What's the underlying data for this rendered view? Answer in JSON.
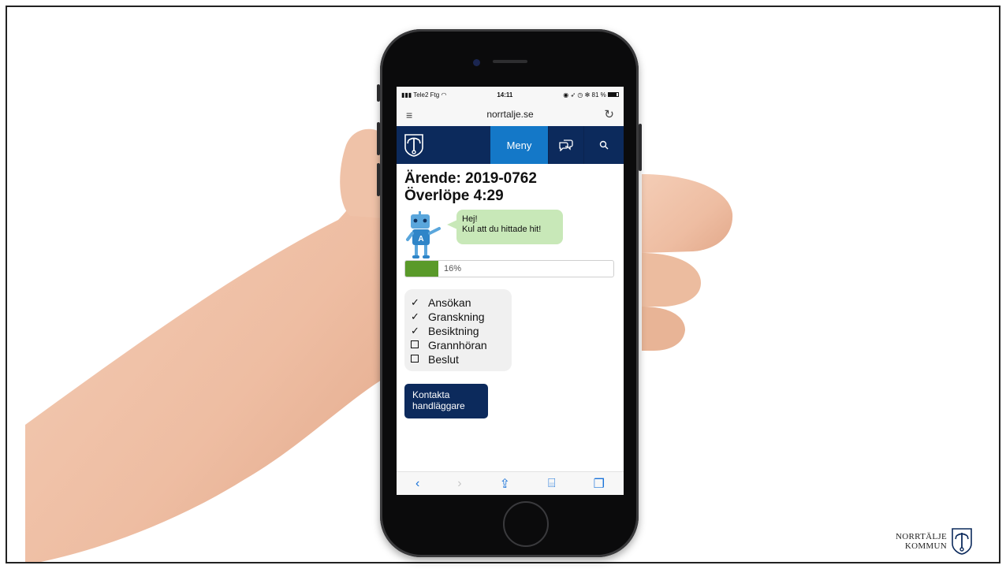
{
  "statusbar": {
    "carrier": "Tele2 Ftg",
    "time": "14:11",
    "battery": "81 %"
  },
  "browser": {
    "url": "norrtalje.se"
  },
  "navbar": {
    "menu_label": "Meny"
  },
  "case": {
    "title_line1": "Ärende: 2019-0762",
    "title_line2": "Överlöpe 4:29"
  },
  "chatbot": {
    "greeting": "Hej!",
    "message": "Kul att du hittade hit!"
  },
  "progress": {
    "value": 0.16,
    "label": "16%"
  },
  "steps": [
    {
      "label": "Ansökan",
      "done": true
    },
    {
      "label": "Granskning",
      "done": true
    },
    {
      "label": "Besiktning",
      "done": true
    },
    {
      "label": "Grannhöran",
      "done": false
    },
    {
      "label": "Beslut",
      "done": false
    }
  ],
  "contact_button": {
    "line1": "Kontakta",
    "line2": "handläggare"
  },
  "brand": {
    "line1": "NORRTÄLJE",
    "line2": "KOMMUN"
  },
  "colors": {
    "navy": "#0c2a5c",
    "menu_blue": "#1478c8",
    "progress_green": "#5a9a2a",
    "bubble_green": "#c8e8b8"
  }
}
